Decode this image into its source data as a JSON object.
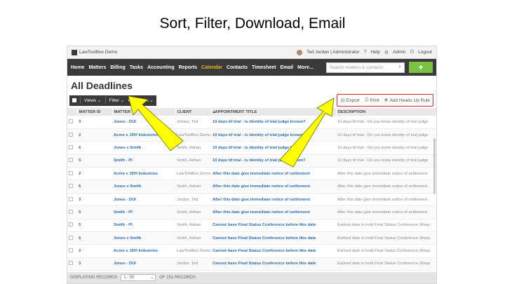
{
  "slide": {
    "title": "Sort, Filter, Download, Email"
  },
  "topbar": {
    "brand": "LawToolBox Demo",
    "user": "Ted Jordan | Administrator",
    "help": "Help",
    "admin": "Admin",
    "logout": "Logout"
  },
  "nav": {
    "items": [
      "Home",
      "Matters",
      "Billing",
      "Tasks",
      "Accounting",
      "Reports",
      "Calendar",
      "Contacts",
      "Timesheet",
      "Email",
      "More..."
    ],
    "active_index": 6,
    "search_placeholder": "Search matters & contacts",
    "add_label": "+"
  },
  "page": {
    "title": "All Deadlines"
  },
  "toolbar": {
    "views": "Views",
    "filter": "Filter",
    "admin": "Admin"
  },
  "actions": {
    "export": "Export",
    "print": "Print",
    "add_rule": "Add Heads Up Rule"
  },
  "table": {
    "headers": [
      "MATTER ID",
      "MATTER",
      "CLIENT",
      "▴APPOINTMENT TITLE",
      "DESCRIPTION"
    ],
    "rows": [
      [
        "3",
        "Jones - DUI",
        "Jordan, Ted",
        "10 days bf trial - is identity of trial judge known?",
        "10 days bf trial - Do you know identity of trial judge"
      ],
      [
        "2",
        "Acme v JDH Industries",
        "LawToolBox Demo",
        "10 days bf trial - is identity of trial judge known?",
        "10 days bf trial - Do you know identity of trial judge"
      ],
      [
        "6",
        "Jones v Smith",
        "Smith, Adrian",
        "10 days bf trial - is identity of trial judge known?",
        "10 days bf trial - Do you know identity of trial judge"
      ],
      [
        "5",
        "Smith - PI",
        "Smith, Adrian",
        "10 days bf trial - is identity of trial judge known?",
        "10 days bf trial - Do you know identity of trial judge"
      ],
      [
        "2",
        "Acme v JDH Industries",
        "LawToolBox Demo",
        "After this date give immediate notice of settlement",
        "After this date give immediate notice of settlement"
      ],
      [
        "6",
        "Jones v Smith",
        "Smith, Adrian",
        "After this date give immediate notice of settlement",
        "After this date give immediate notice of settlement"
      ],
      [
        "3",
        "Jones - DUI",
        "Jordan, Ted",
        "After this date give immediate notice of settlement",
        "After this date give immediate notice of settlement"
      ],
      [
        "5",
        "Smith - PI",
        "Smith, Adrian",
        "After this date give immediate notice of settlement",
        "After this date give immediate notice of settlement"
      ],
      [
        "5",
        "Smith - PI",
        "Smith, Adrian",
        "Cannot have Final Status Conference before this date",
        "Earliest date to hold Final Status Conference (Requ"
      ],
      [
        "6",
        "Jones v Smith",
        "Smith, Adrian",
        "Cannot have Final Status Conference before this date",
        "Earliest date to hold Final Status Conference (Requ"
      ],
      [
        "2",
        "Acme v JDH Industries",
        "LawToolBox Demo",
        "Cannot have Final Status Conference before this date",
        "Earliest date to hold Final Status Conference (Requ"
      ],
      [
        "3",
        "Jones - DUI",
        "Jordan, Ted",
        "Cannot have Final Status Conference before this date",
        "Earliest date to hold Final Status Conference (Requ"
      ]
    ]
  },
  "footer": {
    "label": "DISPLAYING RECORDS",
    "range": "1 - 50",
    "total": "OF 151 RECORDS"
  },
  "colors": {
    "arrow": "#ffff00",
    "highlight_box": "#d9232d",
    "nav_active": "#f2b21b",
    "add_button": "#7cc242"
  }
}
